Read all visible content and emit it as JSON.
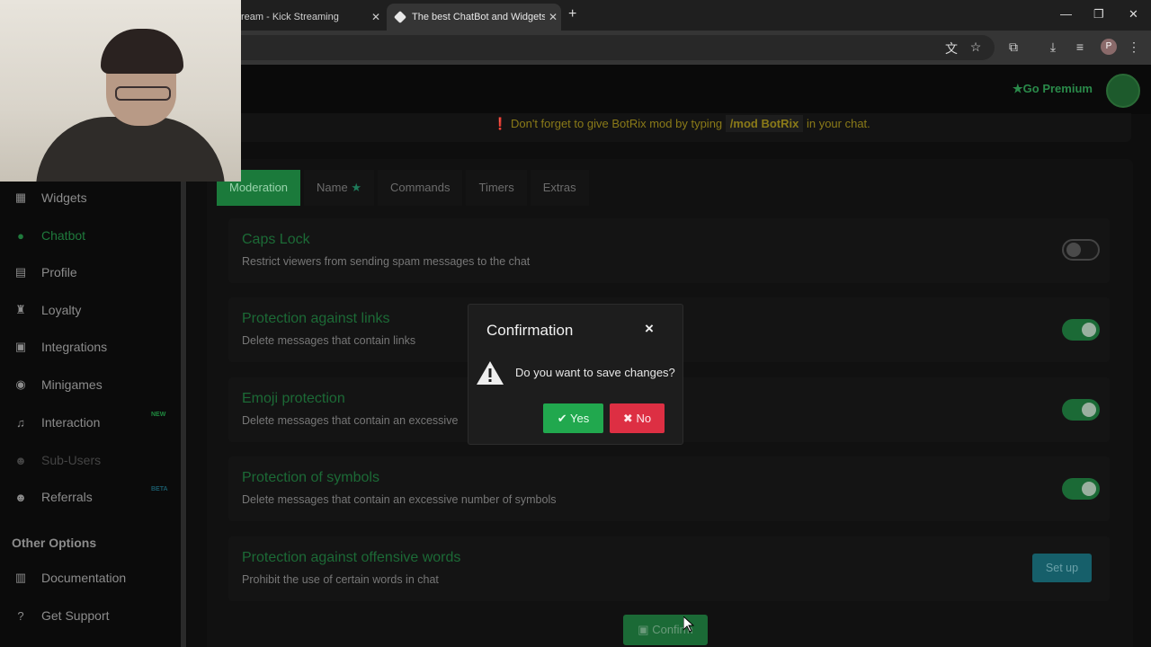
{
  "browser": {
    "tab_inactive_title": "ream - Kick Streaming",
    "tab_active_title": "The best ChatBot and Widgets f",
    "tab_close": "✕",
    "new_tab": "+",
    "minimize": "—",
    "restore": "❐",
    "close": "✕",
    "profile_initial": "P"
  },
  "header": {
    "go_premium": "Go Premium",
    "notice_prefix": "Don't forget to give BotRix mod by typing",
    "notice_command": "/mod BotRix",
    "notice_suffix": "in your chat."
  },
  "sidebar": {
    "items": [
      {
        "label": "Widgets",
        "icon": "grid-icon"
      },
      {
        "label": "Chatbot",
        "icon": "robot-icon"
      },
      {
        "label": "Profile",
        "icon": "id-card-icon"
      },
      {
        "label": "Loyalty",
        "icon": "trophy-icon"
      },
      {
        "label": "Integrations",
        "icon": "plug-icon"
      },
      {
        "label": "Minigames",
        "icon": "gamepad-icon"
      },
      {
        "label": "Interaction",
        "icon": "music-icon",
        "badge": "NEW"
      },
      {
        "label": "Sub-Users",
        "icon": "user-icon"
      },
      {
        "label": "Referrals",
        "icon": "users-icon",
        "badge": "BETA"
      }
    ],
    "other_header": "Other Options",
    "other_items": [
      {
        "label": "Documentation",
        "icon": "book-icon"
      },
      {
        "label": "Get Support",
        "icon": "question-icon"
      }
    ]
  },
  "tabs": [
    {
      "label": "Moderation"
    },
    {
      "label": "Name"
    },
    {
      "label": "Commands"
    },
    {
      "label": "Timers"
    },
    {
      "label": "Extras"
    }
  ],
  "settings": [
    {
      "title": "Caps Lock",
      "desc": "Restrict viewers from sending spam messages to the chat",
      "enabled": false
    },
    {
      "title": "Protection against links",
      "desc": "Delete messages that contain links",
      "enabled": true
    },
    {
      "title": "Emoji protection",
      "desc": "Delete messages that contain an excessive",
      "enabled": true
    },
    {
      "title": "Protection of symbols",
      "desc": "Delete messages that contain an excessive number of symbols",
      "enabled": true
    },
    {
      "title": "Protection against offensive words",
      "desc": "Prohibit the use of certain words in chat",
      "action": "Set up"
    }
  ],
  "confirm_label": "Confirm",
  "modal": {
    "title": "Confirmation",
    "close": "×",
    "message": "Do you want to save changes?",
    "yes": "Yes",
    "no": "No"
  },
  "colors": {
    "accent_green": "#1b7a3b",
    "yes_green": "#21a84e",
    "no_red": "#dd2f43",
    "notice_gold": "#8a7a18"
  }
}
